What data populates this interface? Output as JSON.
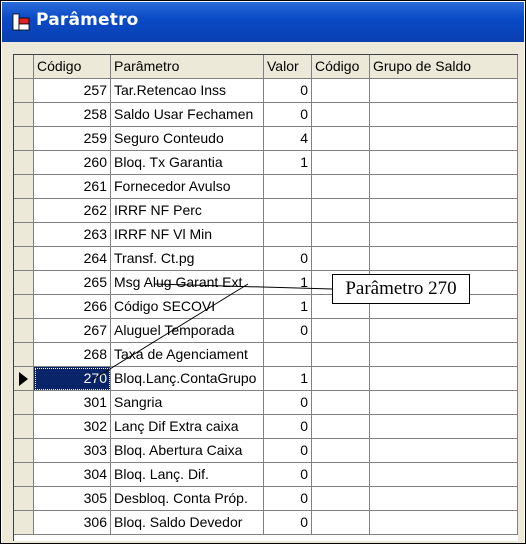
{
  "window": {
    "title": "Parâmetro"
  },
  "grid": {
    "columns": [
      "Código",
      "Parâmetro",
      "Valor",
      "Código",
      "Grupo de Saldo"
    ],
    "rows": [
      {
        "code": "257",
        "param": "Tar.Retencao Inss",
        "value": "0",
        "code2": "",
        "group": ""
      },
      {
        "code": "258",
        "param": "Saldo Usar Fechamen",
        "value": "0",
        "code2": "",
        "group": ""
      },
      {
        "code": "259",
        "param": "Seguro Conteudo",
        "value": "4",
        "code2": "",
        "group": ""
      },
      {
        "code": "260",
        "param": "Bloq. Tx Garantia",
        "value": "1",
        "code2": "",
        "group": ""
      },
      {
        "code": "261",
        "param": "Fornecedor Avulso",
        "value": "",
        "code2": "",
        "group": ""
      },
      {
        "code": "262",
        "param": "IRRF NF Perc",
        "value": "",
        "code2": "",
        "group": ""
      },
      {
        "code": "263",
        "param": "IRRF NF Vl Min",
        "value": "",
        "code2": "",
        "group": ""
      },
      {
        "code": "264",
        "param": "Transf. Ct.pg",
        "value": "0",
        "code2": "",
        "group": ""
      },
      {
        "code": "265",
        "param": "Msg Alug Garant Ext",
        "value": "1",
        "code2": "",
        "group": ""
      },
      {
        "code": "266",
        "param": "Código SECOVI",
        "value": "1",
        "code2": "",
        "group": ""
      },
      {
        "code": "267",
        "param": "Aluguel Temporada",
        "value": "0",
        "code2": "",
        "group": ""
      },
      {
        "code": "268",
        "param": "Taxa de Agenciament",
        "value": "",
        "code2": "",
        "group": ""
      },
      {
        "code": "270",
        "param": "Bloq.Lanç.ContaGrupo",
        "value": "1",
        "code2": "",
        "group": "",
        "selected": true
      },
      {
        "code": "301",
        "param": "Sangria",
        "value": "0",
        "code2": "",
        "group": ""
      },
      {
        "code": "302",
        "param": "Lanç Dif Extra caixa",
        "value": "0",
        "code2": "",
        "group": ""
      },
      {
        "code": "303",
        "param": "Bloq. Abertura Caixa",
        "value": "0",
        "code2": "",
        "group": ""
      },
      {
        "code": "304",
        "param": "Bloq. Lanç. Dif.",
        "value": "0",
        "code2": "",
        "group": ""
      },
      {
        "code": "305",
        "param": "Desbloq. Conta Próp.",
        "value": "0",
        "code2": "",
        "group": ""
      },
      {
        "code": "306",
        "param": "Bloq. Saldo Devedor",
        "value": "0",
        "code2": "",
        "group": ""
      }
    ]
  },
  "callout": {
    "text": "Parâmetro 270"
  },
  "colors": {
    "titlebar": "#0a4bc8",
    "selection": "#0a246a",
    "face": "#ece9d8"
  }
}
